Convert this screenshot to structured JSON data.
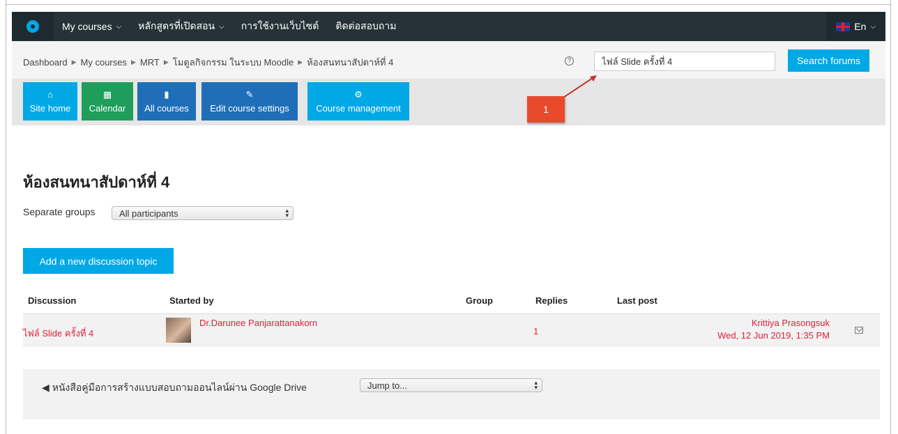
{
  "navbar": {
    "items": [
      {
        "label": "My courses",
        "dropdown": true
      },
      {
        "label": "หลักสูตรที่เปิดสอน",
        "dropdown": true
      },
      {
        "label": "การใช้งานเว็บไซต์",
        "dropdown": false
      },
      {
        "label": "ติดต่อสอบถาม",
        "dropdown": false
      }
    ],
    "language": "En"
  },
  "breadcrumb": [
    "Dashboard",
    "My courses",
    "MRT",
    "โมดูลกิจกรรม ในระบบ Moodle",
    "ห้องสนทนาสัปดาห์ที่ 4"
  ],
  "search": {
    "value": "ไฟล์ Slide ครั้งที่ 4",
    "button": "Search forums"
  },
  "toolbar": {
    "buttons": [
      {
        "label": "Site home",
        "icon": "home-icon",
        "color": "#00a8e6"
      },
      {
        "label": "Calendar",
        "icon": "calendar-icon",
        "color": "#1e9e5a"
      },
      {
        "label": "All courses",
        "icon": "book-icon",
        "color": "#1f6fb8"
      },
      {
        "label": "Edit course settings",
        "icon": "edit-icon",
        "color": "#1f6fb8"
      },
      {
        "label": "Course management",
        "icon": "cogs-icon",
        "color": "#00a8e6"
      }
    ]
  },
  "annotation": {
    "label": "1"
  },
  "page_title": "ห้องสนทนาสัปดาห์ที่ 4",
  "groups": {
    "label": "Separate groups",
    "selected": "All participants"
  },
  "add_button": "Add a new discussion topic",
  "table": {
    "headers": [
      "Discussion",
      "Started by",
      "Group",
      "Replies",
      "Last post"
    ],
    "rows": [
      {
        "discussion": "ไฟล์ Slide ครั้งที่ 4",
        "started_by": "Dr.Darunee Panjarattanakorn",
        "group": "",
        "replies": "1",
        "last_post_user": "Krittiya Prasongsuk",
        "last_post_date": "Wed, 12 Jun 2019, 1:35 PM"
      }
    ]
  },
  "footer_nav": {
    "prev_arrow": "◀",
    "prev_label": "หนังสือคู่มือการสร้างแบบสอบถามออนไลน์ผ่าน Google Drive",
    "jump": "Jump to..."
  }
}
